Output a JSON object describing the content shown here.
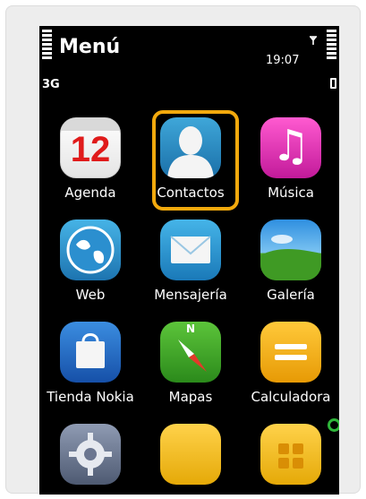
{
  "status": {
    "title": "Menú",
    "network": "3G",
    "time": "19:07",
    "antenna_icon": "𝟏"
  },
  "apps": [
    {
      "label": "Agenda",
      "icon": "calendar-icon",
      "day": "12"
    },
    {
      "label": "Contactos",
      "icon": "contacts-icon",
      "selected": true
    },
    {
      "label": "Música",
      "icon": "music-icon",
      "glyph": "♫"
    },
    {
      "label": "Web",
      "icon": "globe-icon"
    },
    {
      "label": "Mensajería",
      "icon": "mail-icon"
    },
    {
      "label": "Galería",
      "icon": "gallery-icon"
    },
    {
      "label": "Tienda Nokia",
      "icon": "store-bag-icon"
    },
    {
      "label": "Mapas",
      "icon": "compass-icon",
      "glyph": "N"
    },
    {
      "label": "Calculadora",
      "icon": "calculator-icon"
    },
    {
      "label": "",
      "icon": "settings-gear-icon"
    },
    {
      "label": "",
      "icon": "folder-icon"
    },
    {
      "label": "",
      "icon": "apps-folder-icon"
    }
  ],
  "colors": {
    "selection": "#f2a90d",
    "background": "#000000"
  }
}
